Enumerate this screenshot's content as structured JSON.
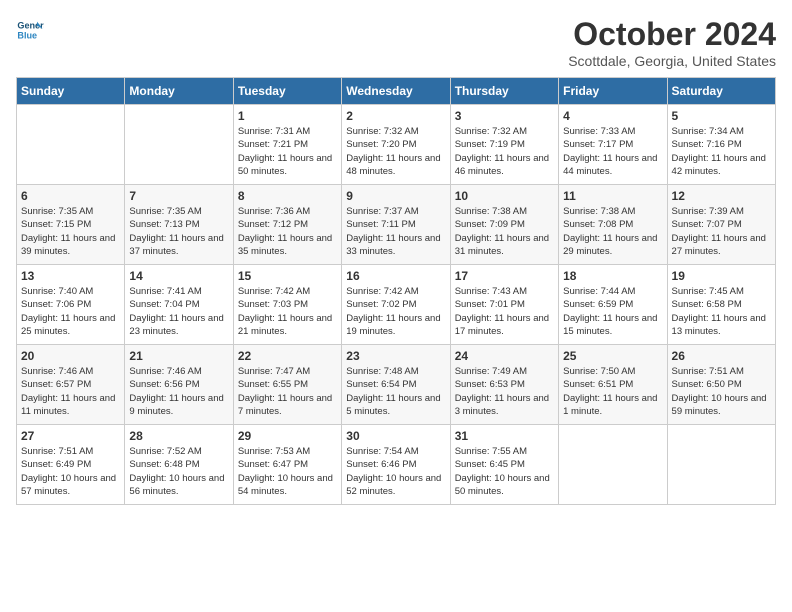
{
  "header": {
    "logo_line1": "General",
    "logo_line2": "Blue",
    "month": "October 2024",
    "location": "Scottdale, Georgia, United States"
  },
  "weekdays": [
    "Sunday",
    "Monday",
    "Tuesday",
    "Wednesday",
    "Thursday",
    "Friday",
    "Saturday"
  ],
  "weeks": [
    [
      {
        "day": "",
        "info": ""
      },
      {
        "day": "",
        "info": ""
      },
      {
        "day": "1",
        "info": "Sunrise: 7:31 AM\nSunset: 7:21 PM\nDaylight: 11 hours and 50 minutes."
      },
      {
        "day": "2",
        "info": "Sunrise: 7:32 AM\nSunset: 7:20 PM\nDaylight: 11 hours and 48 minutes."
      },
      {
        "day": "3",
        "info": "Sunrise: 7:32 AM\nSunset: 7:19 PM\nDaylight: 11 hours and 46 minutes."
      },
      {
        "day": "4",
        "info": "Sunrise: 7:33 AM\nSunset: 7:17 PM\nDaylight: 11 hours and 44 minutes."
      },
      {
        "day": "5",
        "info": "Sunrise: 7:34 AM\nSunset: 7:16 PM\nDaylight: 11 hours and 42 minutes."
      }
    ],
    [
      {
        "day": "6",
        "info": "Sunrise: 7:35 AM\nSunset: 7:15 PM\nDaylight: 11 hours and 39 minutes."
      },
      {
        "day": "7",
        "info": "Sunrise: 7:35 AM\nSunset: 7:13 PM\nDaylight: 11 hours and 37 minutes."
      },
      {
        "day": "8",
        "info": "Sunrise: 7:36 AM\nSunset: 7:12 PM\nDaylight: 11 hours and 35 minutes."
      },
      {
        "day": "9",
        "info": "Sunrise: 7:37 AM\nSunset: 7:11 PM\nDaylight: 11 hours and 33 minutes."
      },
      {
        "day": "10",
        "info": "Sunrise: 7:38 AM\nSunset: 7:09 PM\nDaylight: 11 hours and 31 minutes."
      },
      {
        "day": "11",
        "info": "Sunrise: 7:38 AM\nSunset: 7:08 PM\nDaylight: 11 hours and 29 minutes."
      },
      {
        "day": "12",
        "info": "Sunrise: 7:39 AM\nSunset: 7:07 PM\nDaylight: 11 hours and 27 minutes."
      }
    ],
    [
      {
        "day": "13",
        "info": "Sunrise: 7:40 AM\nSunset: 7:06 PM\nDaylight: 11 hours and 25 minutes."
      },
      {
        "day": "14",
        "info": "Sunrise: 7:41 AM\nSunset: 7:04 PM\nDaylight: 11 hours and 23 minutes."
      },
      {
        "day": "15",
        "info": "Sunrise: 7:42 AM\nSunset: 7:03 PM\nDaylight: 11 hours and 21 minutes."
      },
      {
        "day": "16",
        "info": "Sunrise: 7:42 AM\nSunset: 7:02 PM\nDaylight: 11 hours and 19 minutes."
      },
      {
        "day": "17",
        "info": "Sunrise: 7:43 AM\nSunset: 7:01 PM\nDaylight: 11 hours and 17 minutes."
      },
      {
        "day": "18",
        "info": "Sunrise: 7:44 AM\nSunset: 6:59 PM\nDaylight: 11 hours and 15 minutes."
      },
      {
        "day": "19",
        "info": "Sunrise: 7:45 AM\nSunset: 6:58 PM\nDaylight: 11 hours and 13 minutes."
      }
    ],
    [
      {
        "day": "20",
        "info": "Sunrise: 7:46 AM\nSunset: 6:57 PM\nDaylight: 11 hours and 11 minutes."
      },
      {
        "day": "21",
        "info": "Sunrise: 7:46 AM\nSunset: 6:56 PM\nDaylight: 11 hours and 9 minutes."
      },
      {
        "day": "22",
        "info": "Sunrise: 7:47 AM\nSunset: 6:55 PM\nDaylight: 11 hours and 7 minutes."
      },
      {
        "day": "23",
        "info": "Sunrise: 7:48 AM\nSunset: 6:54 PM\nDaylight: 11 hours and 5 minutes."
      },
      {
        "day": "24",
        "info": "Sunrise: 7:49 AM\nSunset: 6:53 PM\nDaylight: 11 hours and 3 minutes."
      },
      {
        "day": "25",
        "info": "Sunrise: 7:50 AM\nSunset: 6:51 PM\nDaylight: 11 hours and 1 minute."
      },
      {
        "day": "26",
        "info": "Sunrise: 7:51 AM\nSunset: 6:50 PM\nDaylight: 10 hours and 59 minutes."
      }
    ],
    [
      {
        "day": "27",
        "info": "Sunrise: 7:51 AM\nSunset: 6:49 PM\nDaylight: 10 hours and 57 minutes."
      },
      {
        "day": "28",
        "info": "Sunrise: 7:52 AM\nSunset: 6:48 PM\nDaylight: 10 hours and 56 minutes."
      },
      {
        "day": "29",
        "info": "Sunrise: 7:53 AM\nSunset: 6:47 PM\nDaylight: 10 hours and 54 minutes."
      },
      {
        "day": "30",
        "info": "Sunrise: 7:54 AM\nSunset: 6:46 PM\nDaylight: 10 hours and 52 minutes."
      },
      {
        "day": "31",
        "info": "Sunrise: 7:55 AM\nSunset: 6:45 PM\nDaylight: 10 hours and 50 minutes."
      },
      {
        "day": "",
        "info": ""
      },
      {
        "day": "",
        "info": ""
      }
    ]
  ]
}
